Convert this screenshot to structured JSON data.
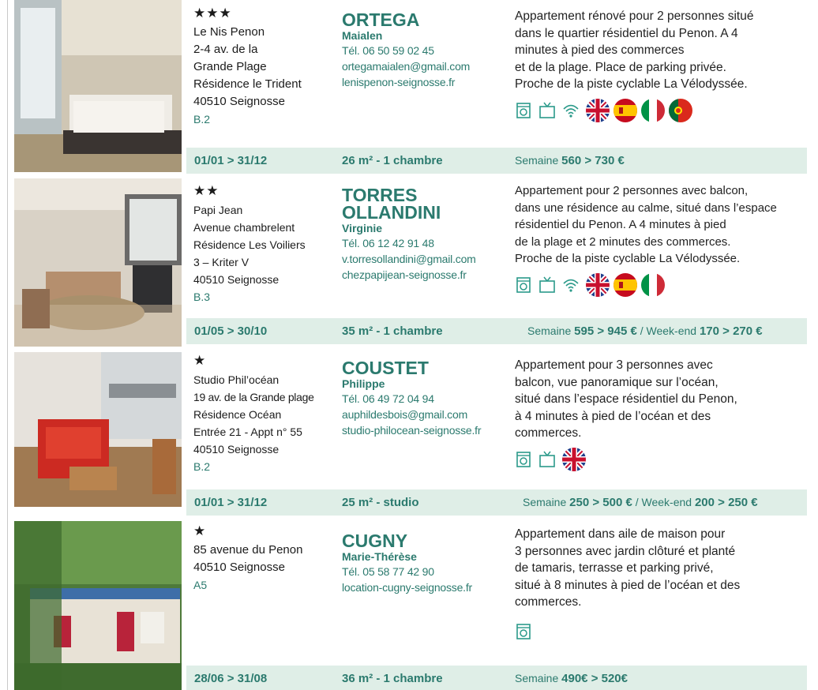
{
  "listings": [
    {
      "stars": "★★★",
      "address": [
        "Le Nis Penon",
        "2-4 av. de la",
        "Grande Plage",
        "Résidence le Trident",
        "40510 Seignosse"
      ],
      "grade": "B.2",
      "surname": [
        "ORTEGA"
      ],
      "firstname": "Maialen",
      "contacts": [
        "Tél. 06 50 59 02 45",
        "ortegamaialen@gmail.com",
        "lenispenon-seignosse.fr"
      ],
      "description": [
        "Appartement rénové pour 2 personnes situé",
        "dans le quartier résidentiel du Penon. A 4",
        "minutes à pied des commerces",
        "et de la plage. Place de parking privée.",
        "Proche de la piste cyclable La Vélodyssée."
      ],
      "icons": [
        "washing-machine-icon",
        "tv-icon",
        "wifi-icon"
      ],
      "flags": [
        "uk-flag",
        "spain-flag",
        "italy-flag",
        "portugal-flag"
      ],
      "dates": "01/01 > 31/12",
      "size": "26 m² - 1 chambre",
      "price_week_label": "Semaine ",
      "price_week": "560 > 730 €",
      "price_weekend_label": "",
      "price_weekend": ""
    },
    {
      "stars": "★★",
      "address": [
        "Papi Jean",
        "Avenue chambrelent",
        "Résidence Les Voiliers",
        "3 – Kriter V",
        "40510 Seignosse"
      ],
      "grade": "B.3",
      "surname": [
        "TORRES",
        "OLLANDINI"
      ],
      "firstname": "Virginie",
      "contacts": [
        "Tél. 06 12 42 91 48",
        "v.torresollandini@gmail.com",
        "chezpapijean-seignosse.fr"
      ],
      "description": [
        "Appartement pour 2 personnes avec balcon,",
        "dans une résidence au calme, situé dans l’espace",
        "résidentiel du Penon. A 4 minutes à pied",
        "de la plage et 2 minutes des commerces.",
        "Proche de la piste cyclable La Vélodyssée."
      ],
      "icons": [
        "washing-machine-icon",
        "tv-icon",
        "wifi-icon"
      ],
      "flags": [
        "uk-flag",
        "spain-flag",
        "italy-flag"
      ],
      "dates": "01/05 > 30/10",
      "size": "35 m² - 1 chambre",
      "price_week_label": "Semaine ",
      "price_week": "595 > 945 €",
      "price_weekend_label": " / Week-end ",
      "price_weekend": "170 > 270 €"
    },
    {
      "stars": "★",
      "address": [
        "Studio Phil’océan",
        "19 av. de la Grande plage",
        "Résidence Océan",
        "Entrée 21 - Appt n° 55",
        "40510 Seignosse"
      ],
      "grade": "B.2",
      "surname": [
        "COUSTET"
      ],
      "firstname": "Philippe",
      "contacts": [
        "Tél. 06 49 72 04 94",
        "auphildesbois@gmail.com",
        "studio-philocean-seignosse.fr"
      ],
      "description": [
        "Appartement pour 3 personnes avec",
        "balcon, vue panoramique sur l’océan,",
        "situé dans l’espace résidentiel du Penon,",
        "à 4 minutes à pied de l’océan et des",
        "commerces."
      ],
      "icons": [
        "washing-machine-icon",
        "tv-icon"
      ],
      "flags": [
        "uk-flag"
      ],
      "dates": "01/01 > 31/12",
      "size": "25 m² - studio",
      "price_week_label": "Semaine ",
      "price_week": "250 > 500 €",
      "price_weekend_label": " / Week-end ",
      "price_weekend": "200 > 250 €"
    },
    {
      "stars": "★",
      "address": [
        "85 avenue du Penon",
        "40510 Seignosse"
      ],
      "grade": "A5",
      "surname": [
        "CUGNY"
      ],
      "firstname": "Marie-Thérèse",
      "contacts": [
        "Tél. 05 58 77 42 90",
        "location-cugny-seignosse.fr"
      ],
      "description": [
        "Appartement dans aile de maison pour",
        "3 personnes avec jardin clôturé et planté",
        "de tamaris, terrasse et parking privé,",
        "situé à 8 minutes à pied de l’océan et des",
        "commerces."
      ],
      "icons": [
        "washing-machine-icon"
      ],
      "flags": [],
      "dates": "28/06 > 31/08",
      "size": "36 m² - 1 chambre",
      "price_week_label": "Semaine ",
      "price_week": "490€ > 520€",
      "price_weekend_label": "",
      "price_weekend": ""
    }
  ]
}
